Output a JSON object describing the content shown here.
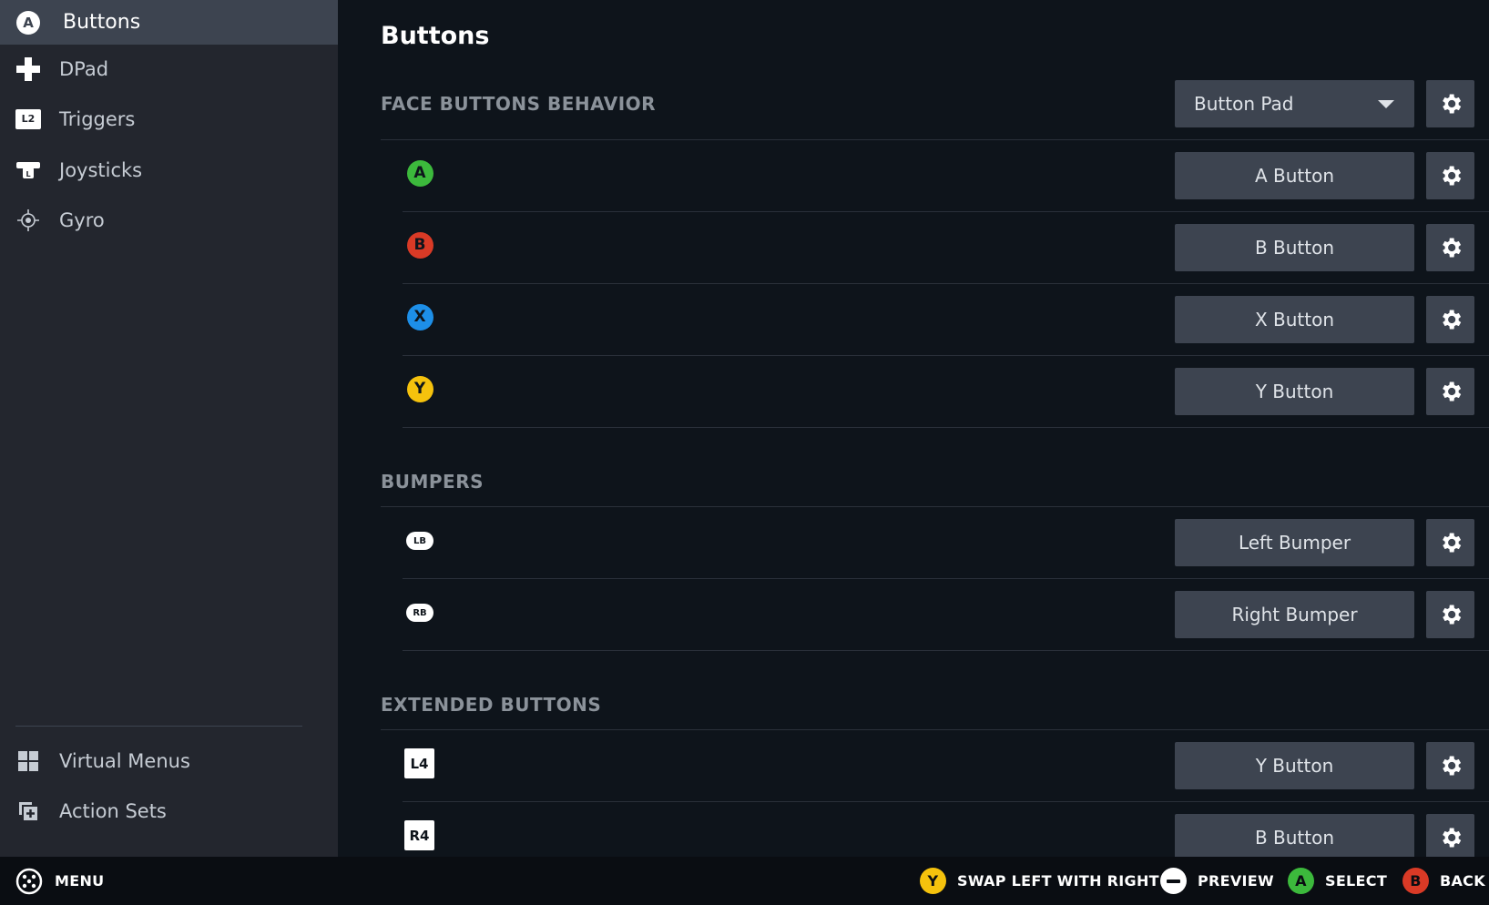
{
  "colors": {
    "a_green": "#3cb93c",
    "b_red": "#d93a26",
    "x_blue": "#1d8fe8",
    "y_yellow": "#f5c20d"
  },
  "sidebar": {
    "items": [
      {
        "label": "Buttons",
        "icon": "a-button-icon",
        "active": true
      },
      {
        "label": "DPad",
        "icon": "dpad-icon"
      },
      {
        "label": "Triggers",
        "icon": "l2-trigger-icon"
      },
      {
        "label": "Joysticks",
        "icon": "joystick-icon"
      },
      {
        "label": "Gyro",
        "icon": "gyro-icon"
      }
    ],
    "bottom_items": [
      {
        "label": "Virtual Menus",
        "icon": "virtual-menus-icon"
      },
      {
        "label": "Action Sets",
        "icon": "action-sets-icon"
      }
    ]
  },
  "main": {
    "title": "Buttons",
    "face": {
      "title": "FACE BUTTONS BEHAVIOR",
      "behavior_value": "Button Pad",
      "rows": [
        {
          "glyph": "A",
          "binding": "A Button"
        },
        {
          "glyph": "B",
          "binding": "B Button"
        },
        {
          "glyph": "X",
          "binding": "X Button"
        },
        {
          "glyph": "Y",
          "binding": "Y Button"
        }
      ]
    },
    "bumpers": {
      "title": "BUMPERS",
      "rows": [
        {
          "glyph": "LB",
          "binding": "Left Bumper"
        },
        {
          "glyph": "RB",
          "binding": "Right Bumper"
        }
      ]
    },
    "extended": {
      "title": "EXTENDED BUTTONS",
      "rows": [
        {
          "glyph": "L4",
          "binding": "Y Button"
        },
        {
          "glyph": "R4",
          "binding": "B Button"
        }
      ]
    }
  },
  "footer": {
    "menu": "MENU",
    "swap": {
      "glyph": "Y",
      "label": "SWAP LEFT WITH RIGHT"
    },
    "preview": {
      "label": "PREVIEW"
    },
    "select": {
      "glyph": "A",
      "label": "SELECT"
    },
    "back": {
      "glyph": "B",
      "label": "BACK"
    }
  }
}
